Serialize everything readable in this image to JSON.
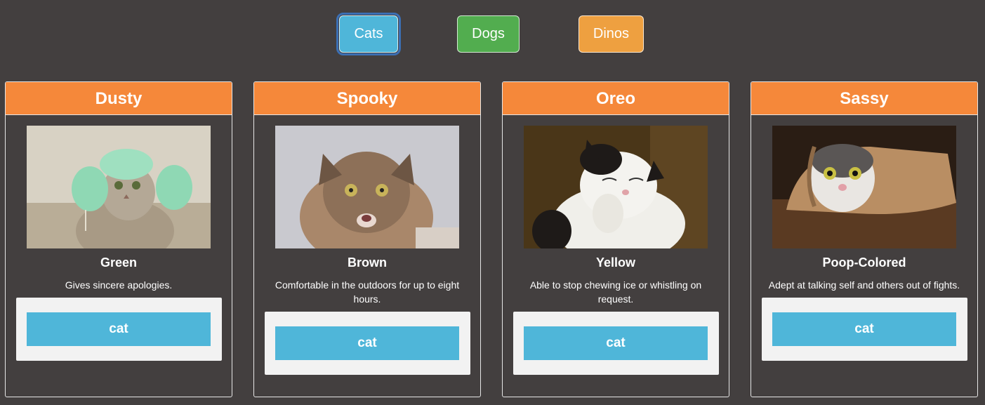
{
  "nav": {
    "buttons": [
      {
        "label": "Cats",
        "color": "#4fb6d9",
        "selected": true
      },
      {
        "label": "Dogs",
        "color": "#52ad4f",
        "selected": false
      },
      {
        "label": "Dinos",
        "color": "#eea040",
        "selected": false
      }
    ]
  },
  "theme": {
    "background": "#433f3f",
    "header": "#f5883a",
    "button": "#4fb6d9"
  },
  "cards": [
    {
      "name": "Dusty",
      "color": "Green",
      "description": "Gives sincere apologies.",
      "button": "cat"
    },
    {
      "name": "Spooky",
      "color": "Brown",
      "description": "Comfortable in the outdoors for up to eight hours.",
      "button": "cat"
    },
    {
      "name": "Oreo",
      "color": "Yellow",
      "description": "Able to stop chewing ice or whistling on request.",
      "button": "cat"
    },
    {
      "name": "Sassy",
      "color": "Poop-Colored",
      "description": "Adept at talking self and others out of fights.",
      "button": "cat"
    }
  ]
}
